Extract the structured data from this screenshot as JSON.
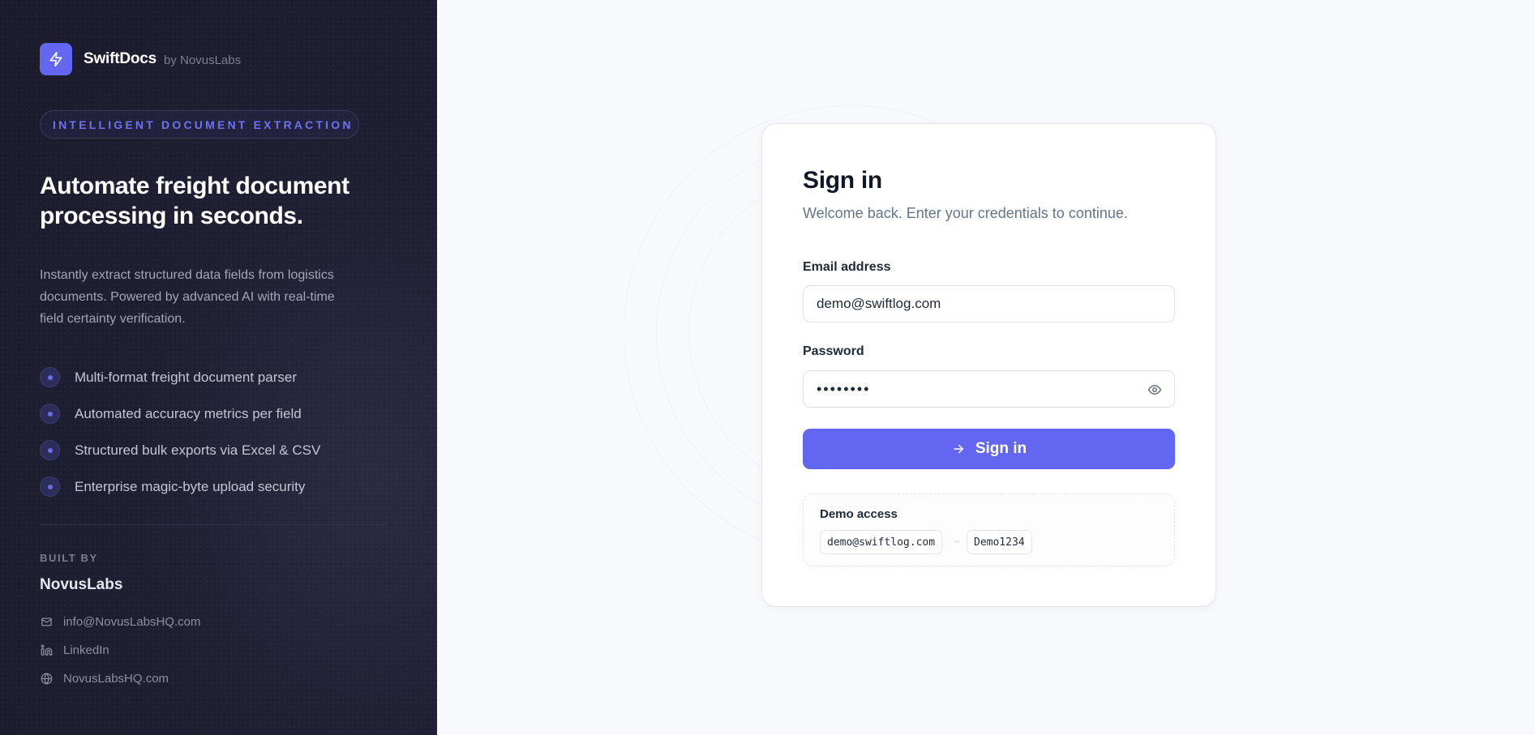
{
  "brand": {
    "name": "SwiftDocs",
    "by": "by NovusLabs",
    "icon": "bolt-icon",
    "accent": "#6366f1"
  },
  "left": {
    "tag": "INTELLIGENT DOCUMENT EXTRACTION",
    "headline": "Automate freight document processing in seconds.",
    "description": "Instantly extract structured data fields from logistics documents. Powered by advanced AI with real-time field certainty verification.",
    "features": [
      "Multi-format freight document parser",
      "Automated accuracy metrics per field",
      "Structured bulk exports via Excel & CSV",
      "Enterprise magic-byte upload security"
    ],
    "built_by_label": "BUILT BY",
    "company": "NovusLabs",
    "contacts": [
      {
        "icon": "mail-icon",
        "label": "info@NovusLabsHQ.com"
      },
      {
        "icon": "linkedin-icon",
        "label": "LinkedIn"
      },
      {
        "icon": "globe-icon",
        "label": "NovusLabsHQ.com"
      }
    ]
  },
  "signin": {
    "title": "Sign in",
    "subtitle": "Welcome back. Enter your credentials to continue.",
    "email_label": "Email address",
    "email_value": "demo@swiftlog.com",
    "password_label": "Password",
    "password_value": "Demo1234",
    "show_password_icon": "eye-icon",
    "button_label": "Sign in",
    "button_icon": "arrow-right-icon",
    "demo": {
      "title": "Demo access",
      "email": "demo@swiftlog.com",
      "password": "Demo1234"
    }
  }
}
